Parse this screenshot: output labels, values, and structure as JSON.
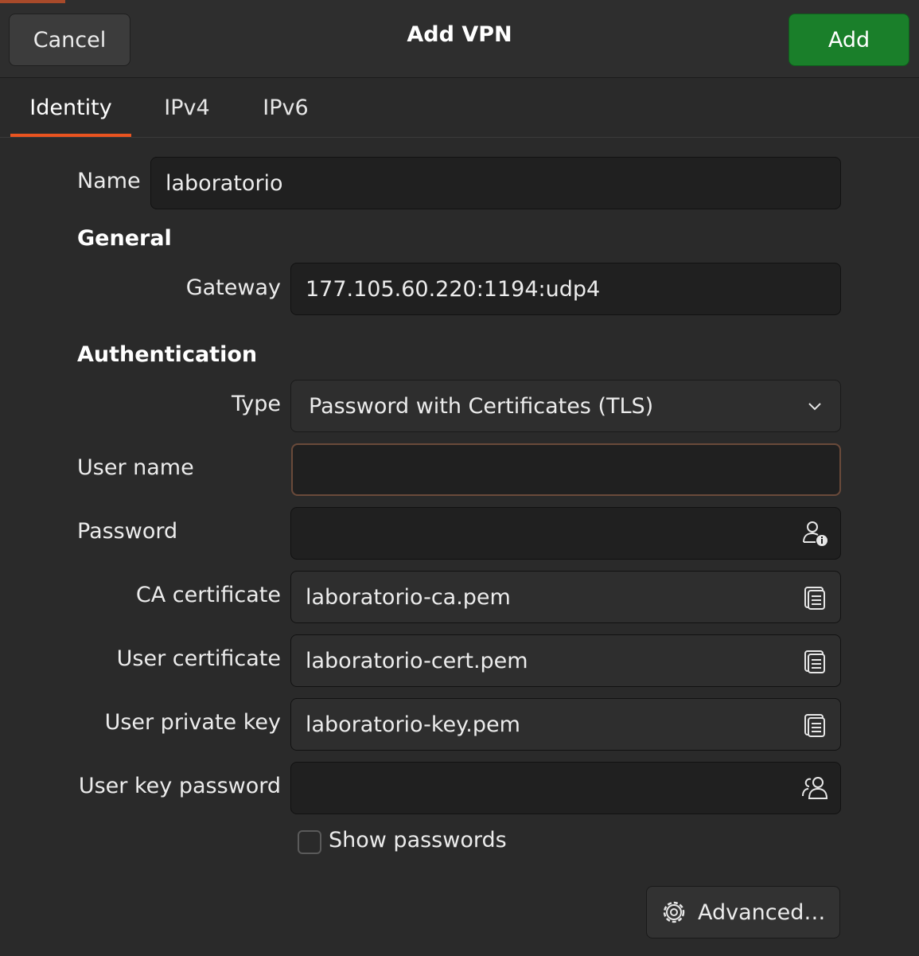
{
  "header": {
    "title": "Add VPN",
    "cancel_label": "Cancel",
    "add_label": "Add"
  },
  "tabs": [
    {
      "label": "Identity",
      "selected": true
    },
    {
      "label": "IPv4",
      "selected": false
    },
    {
      "label": "IPv6",
      "selected": false
    }
  ],
  "identity": {
    "name_label": "Name",
    "name_value": "laboratorio",
    "general_heading": "General",
    "gateway_label": "Gateway",
    "gateway_value": "177.105.60.220:1194:udp4",
    "auth_heading": "Authentication",
    "type_label": "Type",
    "type_value": "Password with Certificates (TLS)",
    "username_label": "User name",
    "username_value": "",
    "password_label": "Password",
    "password_value": "",
    "ca_cert_label": "CA certificate",
    "ca_cert_value": "laboratorio-ca.pem",
    "user_cert_label": "User certificate",
    "user_cert_value": "laboratorio-cert.pem",
    "private_key_label": "User private key",
    "private_key_value": "laboratorio-key.pem",
    "key_password_label": "User key password",
    "key_password_value": "",
    "show_passwords_label": "Show passwords",
    "show_passwords_checked": false,
    "advanced_label": "Advanced…"
  },
  "icons": {
    "password_storage": "user-info-icon",
    "file_chooser": "document-open-icon",
    "key_password_storage": "users-icon",
    "advanced": "gear-icon",
    "dropdown": "chevron-down-icon"
  },
  "colors": {
    "accent": "#e95420",
    "add_button": "#1a7f2a",
    "background": "#2a2a2a"
  }
}
